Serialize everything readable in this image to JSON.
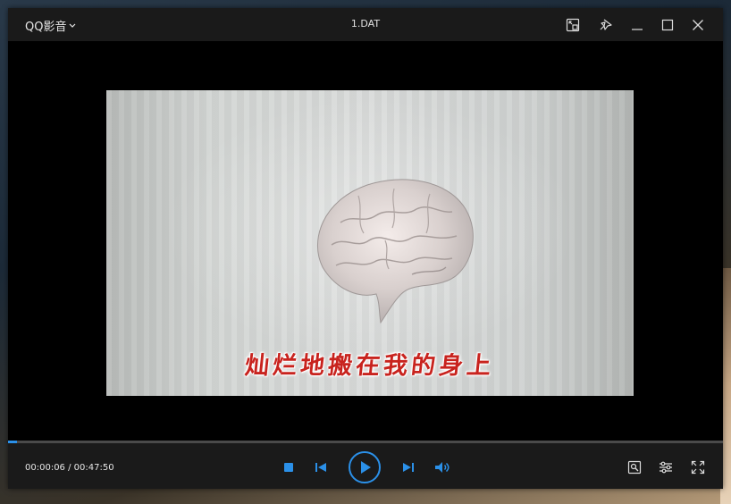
{
  "app": {
    "menu_label": "QQ影音",
    "window_title": "1.DAT"
  },
  "titlebar_icons": [
    "picture-in-picture-icon",
    "pin-icon",
    "minimize-icon",
    "maximize-icon",
    "close-icon"
  ],
  "video": {
    "subtitle": "灿烂地搬在我的身上"
  },
  "playback": {
    "current_time": "00:00:06",
    "total_time": "00:47:50",
    "time_display": "00:00:06 / 00:47:50",
    "progress_fraction": 0.0021
  },
  "controls": [
    "stop-icon",
    "previous-icon",
    "play-icon",
    "next-icon",
    "volume-icon"
  ],
  "right_controls": [
    "screenshot-tool-icon",
    "settings-sliders-icon",
    "fullscreen-icon"
  ],
  "colors": {
    "accent": "#2b90e8",
    "titlebar": "#1a1a1a",
    "subtitle": "#c8231e"
  }
}
